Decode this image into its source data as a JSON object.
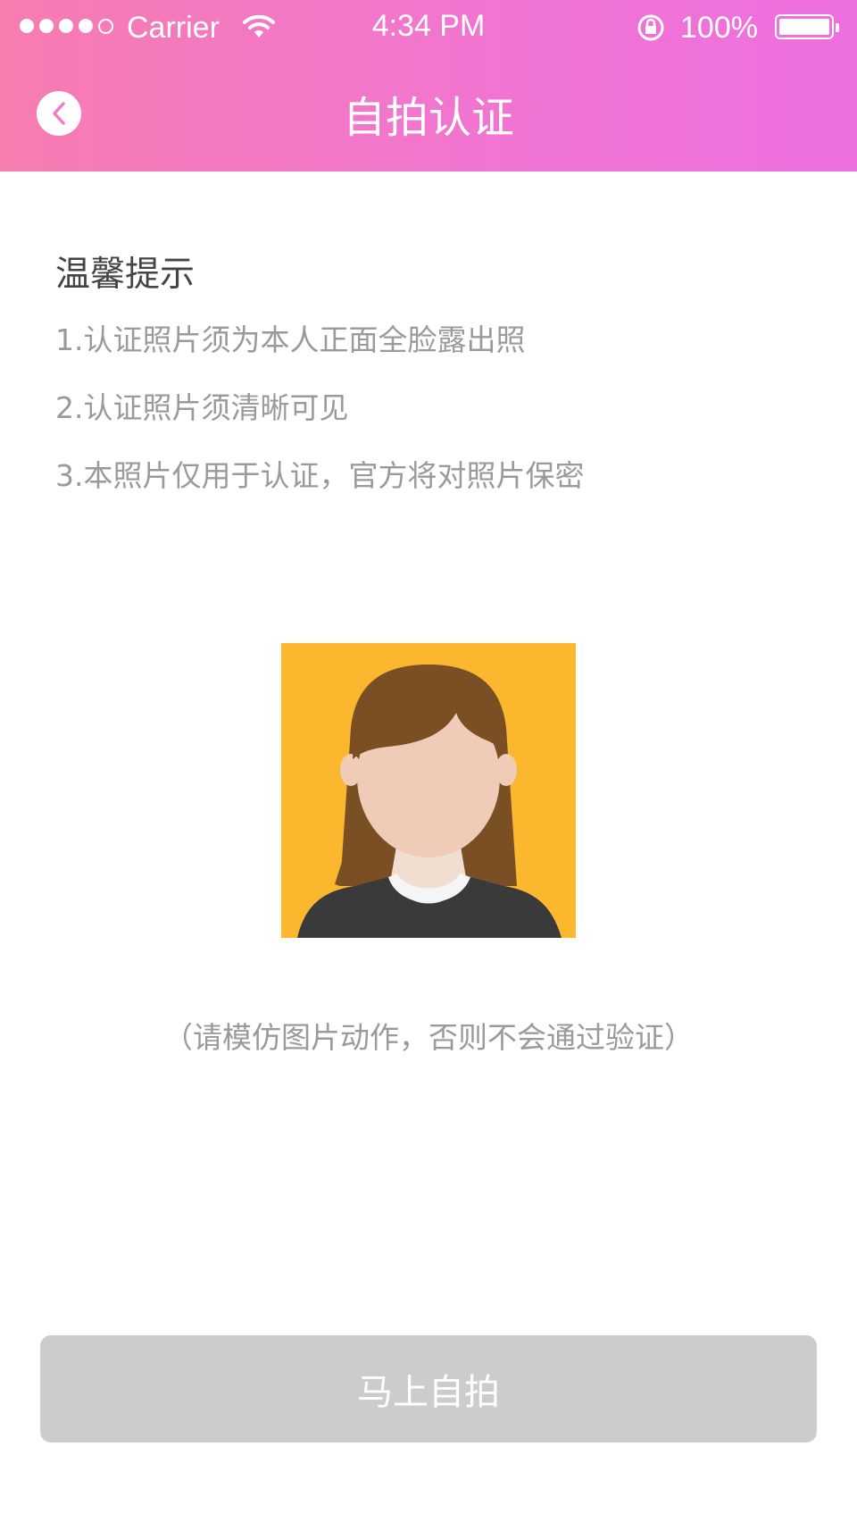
{
  "status_bar": {
    "carrier": "Carrier",
    "time": "4:34 PM",
    "battery": "100%"
  },
  "nav": {
    "title": "自拍认证",
    "back_icon": "chevron-left-icon"
  },
  "tips": {
    "title": "温馨提示",
    "items": [
      "1.认证照片须为本人正面全脸露出照",
      "2.认证照片须清晰可见",
      "3.本照片仅用于认证，官方将对照片保密"
    ]
  },
  "sample_image": {
    "icon": "female-avatar-illustration",
    "background": "#fbb82e"
  },
  "hint": "（请模仿图片动作，否则不会通过验证）",
  "action": {
    "label": "马上自拍",
    "enabled": false
  },
  "colors": {
    "header_start": "#f77cb0",
    "header_end": "#ee6fe0",
    "button_disabled": "#cccccc"
  }
}
